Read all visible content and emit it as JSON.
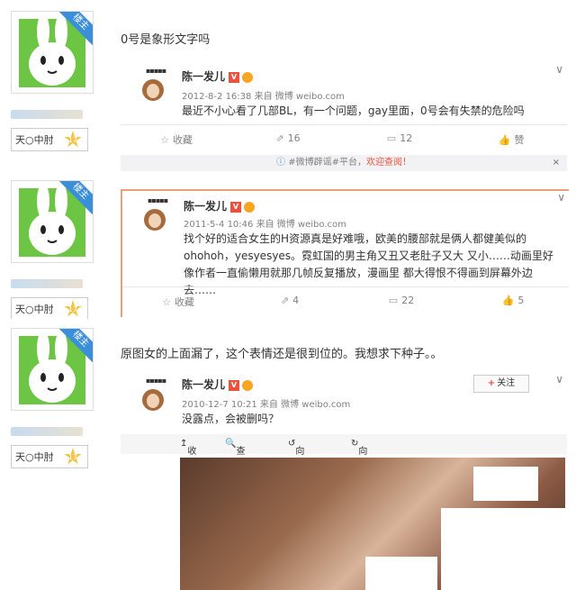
{
  "panels": [
    {
      "badge_user": "天○中肘",
      "corner_label": "楼主",
      "reply_text": "0号是象形文字吗",
      "post": {
        "author": "陈一发儿",
        "meta": "2012-8-2 16:38 来自 微博 weibo.com",
        "text": "最近不小心看了几部BL，有一个问题，gay里面，0号会有失禁的危险吗",
        "actions": {
          "favorite": "收藏",
          "repost": "16",
          "comment": "12",
          "like": "赞"
        },
        "tip": {
          "prefix": "#微博辟谣#平台，",
          "highlight": "欢迎查阅！",
          "close": "×"
        }
      }
    },
    {
      "badge_user": "天○中肘",
      "corner_label": "楼主",
      "post": {
        "author": "陈一发儿",
        "meta": "2011-5-4 10:46 来自 微博 weibo.com",
        "text": "找个好的适合女生的H资源真是好难哦，欧美的腰部就是俩人都健美似的ohohoh，yesyesyes。霓虹国的男主角又丑又老肚子又大 又小……动画里好像作者一直偷懒用就那几帧反复播放，漫画里 都大得恨不得画到屏幕外边去……",
        "actions": {
          "favorite": "收藏",
          "repost": "4",
          "comment": "22",
          "like": "5"
        }
      }
    },
    {
      "badge_user": "天○中肘",
      "corner_label": "楼主",
      "reply_text": "原图女的上面漏了，这个表情还是很到位的。我想求下种子。。",
      "post": {
        "author": "陈一发儿",
        "meta": "2010-12-7 10:21 来自 微博 weibo.com",
        "text": "没露点，会被删吗？",
        "follow": "关注",
        "image_tools": {
          "collapse": "收起",
          "view_large": "查看大图",
          "rotate_left": "向左旋转",
          "rotate_right": "向右旋转"
        }
      }
    }
  ],
  "colors": {
    "accent_blue": "#3b8fd9",
    "vip_red": "#e8523f",
    "star_yellow": "#f3c446"
  }
}
